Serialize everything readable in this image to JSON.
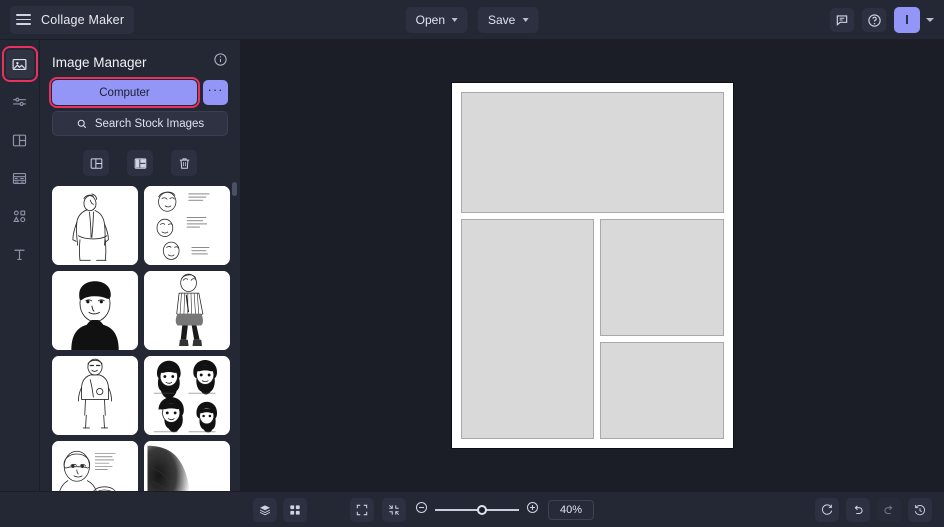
{
  "app": {
    "title": "Collage Maker",
    "menu_icon": "hamburger-icon"
  },
  "topbar": {
    "open_label": "Open",
    "save_label": "Save",
    "feedback_icon": "comment-icon",
    "help_icon": "help-circle-icon",
    "avatar_initial": "I",
    "avatar_color": "#9396f7"
  },
  "rail": {
    "items": [
      {
        "name": "images",
        "icon": "image-icon",
        "selected": true,
        "highlighted": true
      },
      {
        "name": "adjust",
        "icon": "sliders-icon",
        "selected": false,
        "highlighted": false
      },
      {
        "name": "layouts",
        "icon": "layout-icon",
        "selected": false,
        "highlighted": false
      },
      {
        "name": "backgrounds",
        "icon": "background-icon",
        "selected": false,
        "highlighted": false
      },
      {
        "name": "graphics",
        "icon": "shapes-icon",
        "selected": false,
        "highlighted": false
      },
      {
        "name": "text",
        "icon": "text-icon",
        "selected": false,
        "highlighted": false
      }
    ]
  },
  "panel": {
    "title": "Image Manager",
    "info_icon": "info-circle-icon",
    "computer_button": "Computer",
    "more_button": "···",
    "search_button": "Search Stock Images",
    "search_icon": "search-icon",
    "tools": [
      {
        "name": "select-all",
        "icon": "select-all-icon"
      },
      {
        "name": "fill-layout",
        "icon": "fill-layout-icon"
      },
      {
        "name": "delete",
        "icon": "trash-icon"
      }
    ],
    "thumbnails": [
      {
        "name": "sketch-standing-figure",
        "caption": ""
      },
      {
        "name": "sketch-face-studies-notes",
        "caption": ""
      },
      {
        "name": "sketch-inked-portrait",
        "caption": ""
      },
      {
        "name": "sketch-striped-outfit-figure",
        "caption": ""
      },
      {
        "name": "sketch-standing-woman",
        "caption": ""
      },
      {
        "name": "sketch-four-faces",
        "caption": ""
      },
      {
        "name": "sketch-two-portraits-notes",
        "caption": ""
      },
      {
        "name": "sketch-shaded-landscape",
        "caption": ""
      }
    ]
  },
  "canvas": {
    "cells": [
      {
        "name": "cell-top"
      },
      {
        "name": "cell-left"
      },
      {
        "name": "cell-right-top"
      },
      {
        "name": "cell-right-bottom"
      }
    ],
    "page_color": "#ffffff",
    "cell_color": "#d9d9d9"
  },
  "bottombar": {
    "left_tools": [
      {
        "name": "layers",
        "icon": "layers-icon"
      },
      {
        "name": "grid",
        "icon": "grid-icon"
      }
    ],
    "fit_icon": "fit-screen-icon",
    "collapse_icon": "collapse-icon",
    "zoom_out_icon": "zoom-out-icon",
    "zoom_in_icon": "zoom-in-icon",
    "zoom_value": "40%",
    "right_tools": [
      {
        "name": "reset",
        "icon": "refresh-icon",
        "disabled": false
      },
      {
        "name": "undo",
        "icon": "undo-icon",
        "disabled": false
      },
      {
        "name": "redo",
        "icon": "redo-icon",
        "disabled": true
      },
      {
        "name": "history",
        "icon": "history-icon",
        "disabled": false
      }
    ]
  }
}
